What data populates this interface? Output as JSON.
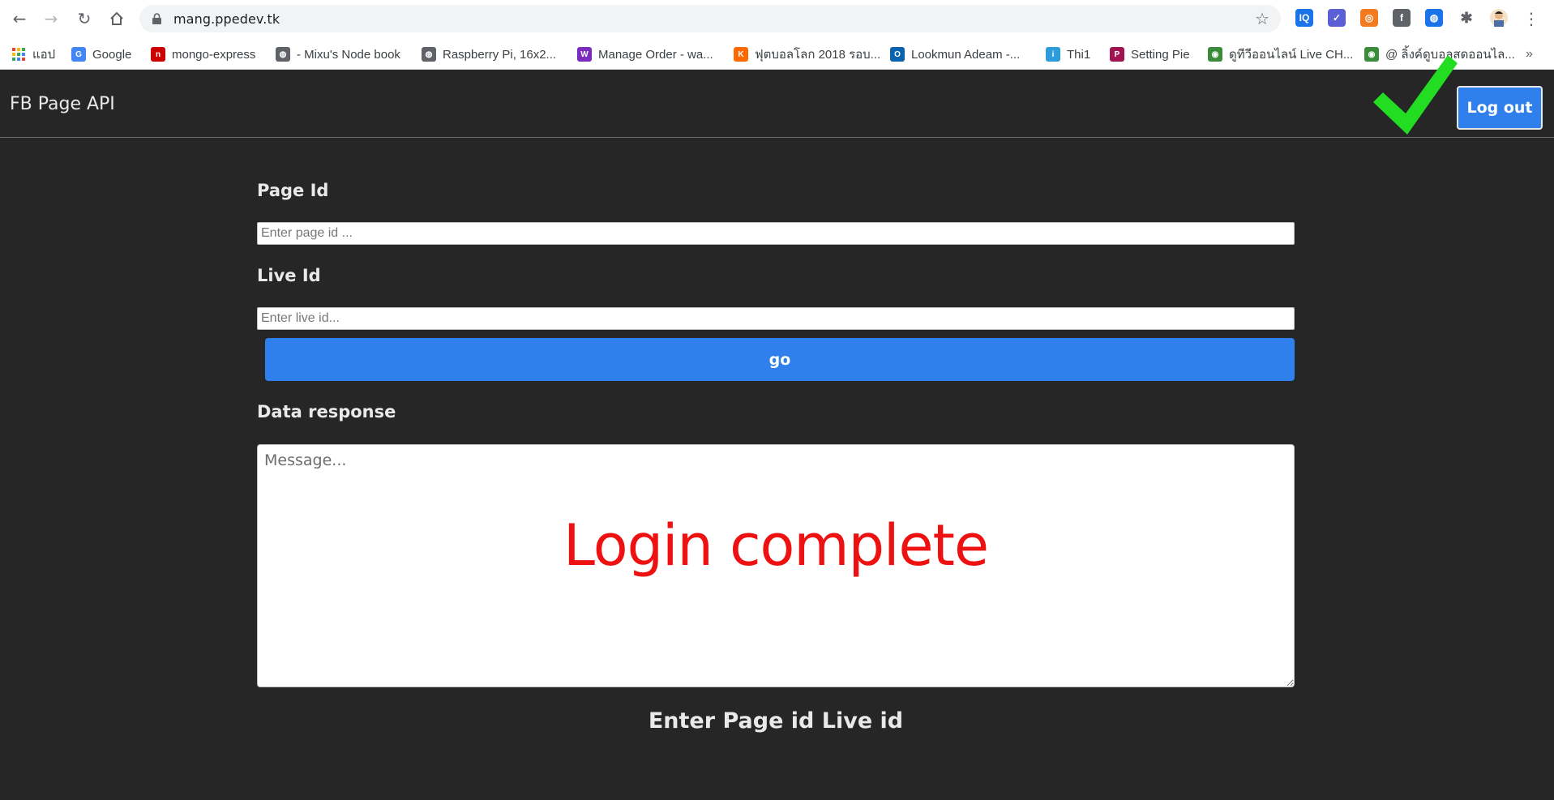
{
  "browser": {
    "url": "mang.ppedev.tk",
    "extensions": [
      {
        "name": "iq-extension",
        "text": "IQ",
        "color": "#1a73e8"
      },
      {
        "name": "check-circle-extension",
        "text": "✓",
        "color": "#5b5fd6"
      },
      {
        "name": "lifebuoy-extension",
        "text": "◎",
        "color": "#f47a20"
      },
      {
        "name": "facebook-extension",
        "text": "f",
        "color": "#5f6368"
      },
      {
        "name": "globe-extension",
        "text": "◍",
        "color": "#1a73e8"
      }
    ]
  },
  "bookmarks": [
    {
      "label": "แอป",
      "icon": "apps-grid-icon",
      "color": "#e8453c"
    },
    {
      "label": "Google",
      "icon": "google-icon",
      "color": "#4285f4",
      "glyph": "G"
    },
    {
      "label": "mongo-express",
      "icon": "mongo-express-icon",
      "color": "#cc0000",
      "glyph": "n"
    },
    {
      "label": "- Mixu's Node book",
      "icon": "globe-icon",
      "color": "#5f6368",
      "glyph": "◍"
    },
    {
      "label": "Raspberry Pi, 16x2...",
      "icon": "globe-icon",
      "color": "#5f6368",
      "glyph": "◍"
    },
    {
      "label": "Manage Order - wa...",
      "icon": "wp-icon",
      "color": "#7b2cbf",
      "glyph": "W"
    },
    {
      "label": "ฟุตบอลโลก 2018 รอบ...",
      "icon": "k-icon",
      "color": "#ff6a00",
      "glyph": "K"
    },
    {
      "label": "Lookmun Adeam -...",
      "icon": "outlook-icon",
      "color": "#0a64ad",
      "glyph": "O"
    },
    {
      "label": "Thi1",
      "icon": "ibb-icon",
      "color": "#2d9cdb",
      "glyph": "i"
    },
    {
      "label": "Setting Pie",
      "icon": "pie-icon",
      "color": "#a0154f",
      "glyph": "P"
    },
    {
      "label": "ดูทีวีออนไลน์ Live CH...",
      "icon": "tv-icon",
      "color": "#3a8b3a",
      "glyph": "◉"
    },
    {
      "label": "@ ลิ้งค์ดูบอลสดออนไล...",
      "icon": "ball-icon",
      "color": "#3a8b3a",
      "glyph": "◉"
    }
  ],
  "bookmarks_overflow": "»",
  "app": {
    "brand": "FB Page API",
    "logout_label": "Log out",
    "page_id_label": "Page Id",
    "page_id_placeholder": "Enter page id ...",
    "live_id_label": "Live Id",
    "live_id_placeholder": "Enter live id...",
    "go_label": "go",
    "data_response_label": "Data response",
    "data_response_placeholder": "Message...",
    "overlay_text": "Login complete",
    "footer_hint": "Enter Page id Live id"
  },
  "colors": {
    "accent": "#2f80ed",
    "background": "#262626",
    "overlay": "#ee1111",
    "checkmark": "#22dd22"
  }
}
